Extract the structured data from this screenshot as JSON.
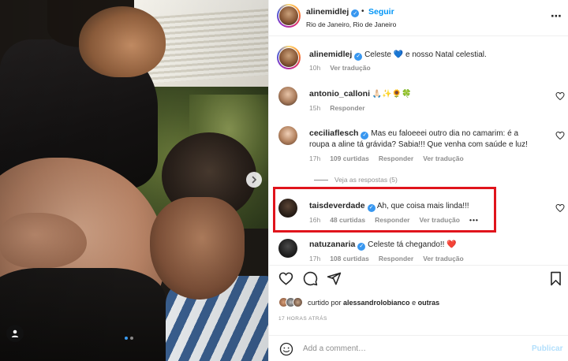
{
  "post": {
    "author": "alinemidlej",
    "follow_label": "Seguir",
    "separator": "•",
    "location": "Rio de Janeiro, Rio de Janeiro",
    "caption": {
      "username": "alinemidlej",
      "text": "Celeste 💙 e nosso Natal celestial.",
      "time": "10h",
      "translate": "Ver tradução"
    }
  },
  "comments": [
    {
      "username": "antonio_calloni",
      "text": "🙏🏻✨🌻🍀",
      "time": "15h",
      "likes": "",
      "reply": "Responder",
      "translate": ""
    },
    {
      "username": "ceciliaflesch",
      "text": "Mas eu faloeeei outro dia no camarim: é a roupa a aline tá grávida? Sabia!!! Que venha com saúde e luz!",
      "time": "17h",
      "likes": "109 curtidas",
      "reply": "Responder",
      "translate": "Ver tradução"
    },
    {
      "username": "taisdeverdade",
      "text": "Ah, que coisa mais linda!!!",
      "time": "16h",
      "likes": "48 curtidas",
      "reply": "Responder",
      "translate": "Ver tradução",
      "more": "•••"
    },
    {
      "username": "natuzanaria",
      "text": "Celeste tá chegando!! ❤️",
      "time": "17h",
      "likes": "108 curtidas",
      "reply": "Responder",
      "translate": "Ver tradução"
    }
  ],
  "view_replies": "Veja as respostas (5)",
  "liked_by": {
    "prefix": "curtido por ",
    "user": "alessandrolobianco",
    "connector": "e ",
    "others": "outras"
  },
  "time_ago": "17 HORAS ATRÁS",
  "add_comment": {
    "placeholder": "Add a comment…",
    "publish": "Publicar"
  },
  "colors": {
    "link_blue": "#0095f6",
    "verified_blue": "#3897f0",
    "highlight_red": "#e0141c",
    "muted_text": "#8e8e8e"
  }
}
